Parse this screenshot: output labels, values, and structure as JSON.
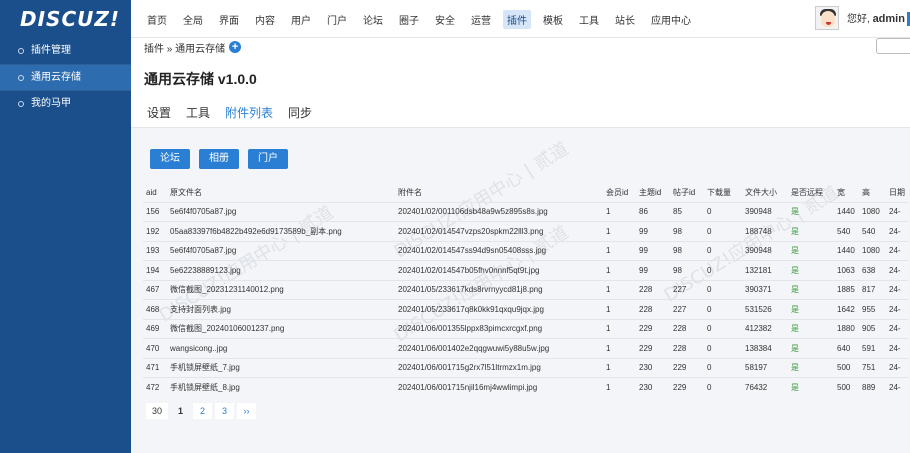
{
  "logo": "DISCUZ!",
  "nav": [
    "首页",
    "全局",
    "界面",
    "内容",
    "用户",
    "门户",
    "论坛",
    "圈子",
    "安全",
    "运营",
    "插件",
    "模板",
    "工具",
    "站长",
    "应用中心"
  ],
  "nav_active_index": 10,
  "user": {
    "greeting": "您好, ",
    "name": "admin"
  },
  "sidebar": [
    "插件管理",
    "通用云存储",
    "我的马甲"
  ],
  "sidebar_active_index": 1,
  "breadcrumb": "插件 » 通用云存储",
  "page_title": "通用云存储 v1.0.0",
  "tabs": [
    "设置",
    "工具",
    "附件列表",
    "同步"
  ],
  "tab_active_index": 2,
  "buttons": [
    "论坛",
    "相册",
    "门户"
  ],
  "table": {
    "headers": [
      "aid",
      "原文件名",
      "附件名",
      "会员id",
      "主题id",
      "帖子id",
      "下载量",
      "文件大小",
      "是否远程",
      "宽",
      "高",
      "日期"
    ],
    "rows": [
      [
        "156",
        "5e6f4f0705a87.jpg",
        "202401/02/001106dsb48a9w5z895s8s.jpg",
        "1",
        "86",
        "85",
        "0",
        "390948",
        "是",
        "1440",
        "1080",
        "24-"
      ],
      [
        "192",
        "05aa83397f6b4822b492e6d9173589b_副本.png",
        "202401/02/014547vzps20spkm22lll3.png",
        "1",
        "99",
        "98",
        "0",
        "188748",
        "是",
        "540",
        "540",
        "24-"
      ],
      [
        "193",
        "5e6f4f0705a87.jpg",
        "202401/02/014547ss94d9sn05408sss.jpg",
        "1",
        "99",
        "98",
        "0",
        "390948",
        "是",
        "1440",
        "1080",
        "24-"
      ],
      [
        "194",
        "5e62238889123.jpg",
        "202401/02/014547b05fhv0nnnf5qt9t.jpg",
        "1",
        "99",
        "98",
        "0",
        "132181",
        "是",
        "1063",
        "638",
        "24-"
      ],
      [
        "467",
        "微信截图_20231231140012.png",
        "202401/05/233617kds8rvrnyycd81j8.png",
        "1",
        "228",
        "227",
        "0",
        "390371",
        "是",
        "1885",
        "817",
        "24-"
      ],
      [
        "468",
        "支持封面列表.jpg",
        "202401/05/233617q8k0kk91qxqu9jqx.jpg",
        "1",
        "228",
        "227",
        "0",
        "531526",
        "是",
        "1642",
        "955",
        "24-"
      ],
      [
        "469",
        "微信截图_20240106001237.png",
        "202401/06/001355lppx83pimcxrcgxf.png",
        "1",
        "229",
        "228",
        "0",
        "412382",
        "是",
        "1880",
        "905",
        "24-"
      ],
      [
        "470",
        "wangsicong..jpg",
        "202401/06/001402e2qqgwuwi5y88u5w.jpg",
        "1",
        "229",
        "228",
        "0",
        "138384",
        "是",
        "640",
        "591",
        "24-"
      ],
      [
        "471",
        "手机锁屏壁纸_7.jpg",
        "202401/06/001715g2rx7l51ltrmzx1m.jpg",
        "1",
        "230",
        "229",
        "0",
        "58197",
        "是",
        "500",
        "751",
        "24-"
      ],
      [
        "472",
        "手机锁屏壁纸_8.jpg",
        "202401/06/001715njil16mj4wwlimpi.jpg",
        "1",
        "230",
        "229",
        "0",
        "76432",
        "是",
        "500",
        "889",
        "24-"
      ]
    ]
  },
  "pager": {
    "total": "30",
    "pages": [
      "1",
      "2",
      "3"
    ],
    "current": "1",
    "next": "››"
  },
  "watermark": "DISCUZ!应用中心 | 贰道"
}
